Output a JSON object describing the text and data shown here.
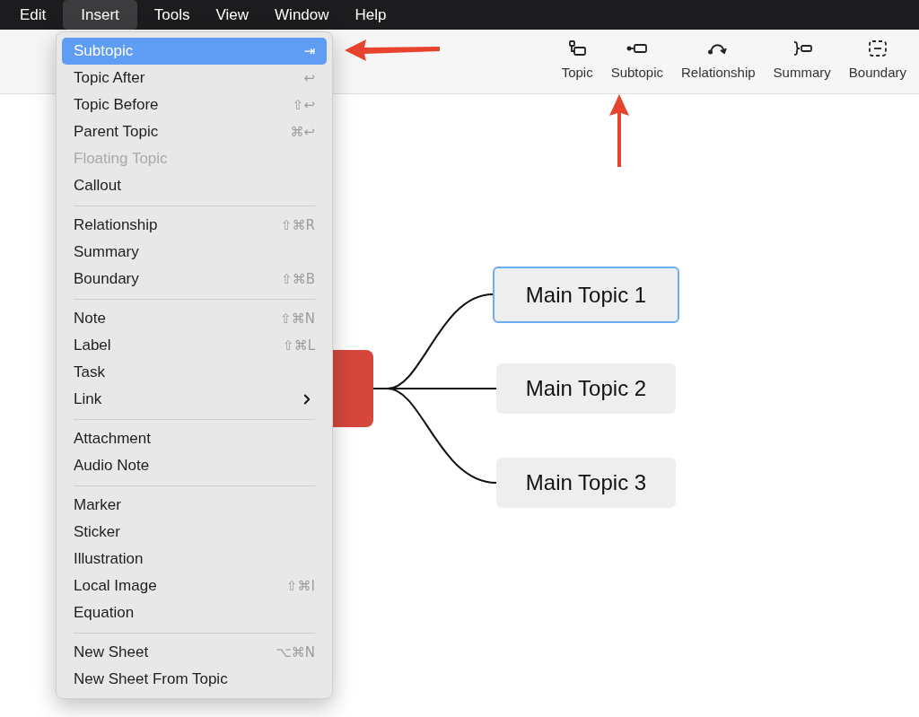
{
  "menu_bar": [
    {
      "label": "Edit",
      "selected": false
    },
    {
      "label": "Insert",
      "selected": true
    },
    {
      "label": "Tools",
      "selected": false
    },
    {
      "label": "View",
      "selected": false
    },
    {
      "label": "Window",
      "selected": false
    },
    {
      "label": "Help",
      "selected": false
    }
  ],
  "toolbar": [
    {
      "label": "Topic",
      "kind": "topic"
    },
    {
      "label": "Subtopic",
      "kind": "subtopic"
    },
    {
      "label": "Relationship",
      "kind": "relationship"
    },
    {
      "label": "Summary",
      "kind": "summary"
    },
    {
      "label": "Boundary",
      "kind": "boundary"
    }
  ],
  "insert_menu": [
    [
      {
        "label": "Subtopic",
        "shortcut": "⇥",
        "selected": true,
        "disabled": false,
        "kind": "item"
      },
      {
        "label": "Topic After",
        "shortcut": "↩",
        "selected": false,
        "disabled": false,
        "kind": "item"
      },
      {
        "label": "Topic Before",
        "shortcut": "⇧↩",
        "selected": false,
        "disabled": false,
        "kind": "item"
      },
      {
        "label": "Parent Topic",
        "shortcut": "⌘↩",
        "selected": false,
        "disabled": false,
        "kind": "item"
      },
      {
        "label": "Floating Topic",
        "selected": false,
        "disabled": true,
        "kind": "item"
      },
      {
        "label": "Callout",
        "selected": false,
        "disabled": false,
        "kind": "item"
      }
    ],
    [
      {
        "label": "Relationship",
        "shortcut": "⇧⌘R",
        "selected": false,
        "disabled": false,
        "kind": "item"
      },
      {
        "label": "Summary",
        "selected": false,
        "disabled": false,
        "kind": "item"
      },
      {
        "label": "Boundary",
        "shortcut": "⇧⌘B",
        "selected": false,
        "disabled": false,
        "kind": "item"
      }
    ],
    [
      {
        "label": "Note",
        "shortcut": "⇧⌘N",
        "selected": false,
        "disabled": false,
        "kind": "item"
      },
      {
        "label": "Label",
        "shortcut": "⇧⌘L",
        "selected": false,
        "disabled": false,
        "kind": "item"
      },
      {
        "label": "Task",
        "selected": false,
        "disabled": false,
        "kind": "item"
      },
      {
        "label": "Link",
        "selected": false,
        "disabled": false,
        "kind": "submenu"
      }
    ],
    [
      {
        "label": "Attachment",
        "selected": false,
        "disabled": false,
        "kind": "item"
      },
      {
        "label": "Audio Note",
        "selected": false,
        "disabled": false,
        "kind": "item"
      }
    ],
    [
      {
        "label": "Marker",
        "selected": false,
        "disabled": false,
        "kind": "item"
      },
      {
        "label": "Sticker",
        "selected": false,
        "disabled": false,
        "kind": "item"
      },
      {
        "label": "Illustration",
        "selected": false,
        "disabled": false,
        "kind": "item"
      },
      {
        "label": "Local Image",
        "shortcut": "⇧⌘I",
        "selected": false,
        "disabled": false,
        "kind": "item"
      },
      {
        "label": "Equation",
        "selected": false,
        "disabled": false,
        "kind": "item"
      }
    ],
    [
      {
        "label": "New Sheet",
        "shortcut": "⌥⌘N",
        "selected": false,
        "disabled": false,
        "kind": "item"
      },
      {
        "label": "New Sheet From Topic",
        "selected": false,
        "disabled": false,
        "kind": "item"
      }
    ]
  ],
  "mind_map": {
    "topics": [
      {
        "label": "Main Topic 1",
        "selected": true
      },
      {
        "label": "Main Topic 2",
        "selected": false
      },
      {
        "label": "Main Topic 3",
        "selected": false
      }
    ]
  }
}
